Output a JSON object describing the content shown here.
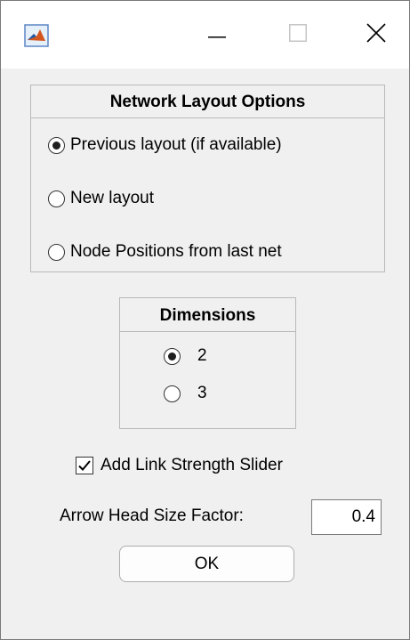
{
  "window": {
    "icon": "matlab-icon",
    "controls": {
      "minimize": "minimize-icon",
      "maximize": "maximize-icon",
      "close": "close-icon"
    }
  },
  "layout_options": {
    "title": "Network Layout Options",
    "options": [
      {
        "label": "Previous layout (if available)",
        "selected": true
      },
      {
        "label": "New layout",
        "selected": false
      },
      {
        "label": "Node Positions from last net",
        "selected": false
      }
    ]
  },
  "dimensions": {
    "title": "Dimensions",
    "options": [
      {
        "label": "2",
        "selected": true
      },
      {
        "label": "3",
        "selected": false
      }
    ]
  },
  "link_slider": {
    "label": "Add Link Strength Slider",
    "checked": true
  },
  "arrow_head": {
    "label": "Arrow Head Size Factor:",
    "value": "0.4"
  },
  "ok_button": {
    "label": "OK"
  }
}
